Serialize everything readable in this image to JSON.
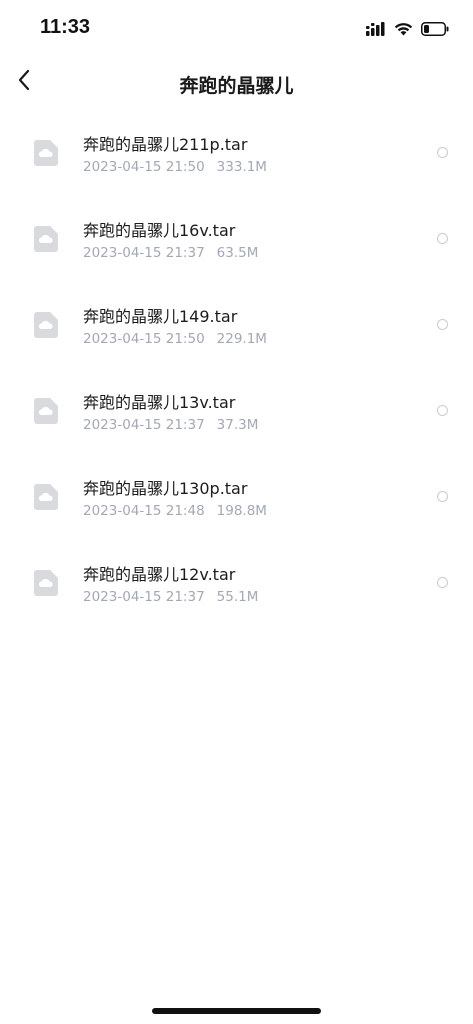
{
  "status_bar": {
    "time": "11:33",
    "icons": [
      "cellular-signal-icon",
      "wifi-icon",
      "battery-icon"
    ]
  },
  "nav": {
    "title": "奔跑的晶骡儿",
    "back_icon": "chevron-left-icon"
  },
  "files": [
    {
      "name": "奔跑的晶骡儿211p.tar",
      "date": "2023-04-15 21:50",
      "size": "333.1M"
    },
    {
      "name": "奔跑的晶骡儿16v.tar",
      "date": "2023-04-15 21:37",
      "size": "63.5M"
    },
    {
      "name": "奔跑的晶骡儿149.tar",
      "date": "2023-04-15 21:50",
      "size": "229.1M"
    },
    {
      "name": "奔跑的晶骡儿13v.tar",
      "date": "2023-04-15 21:37",
      "size": "37.3M"
    },
    {
      "name": "奔跑的晶骡儿130p.tar",
      "date": "2023-04-15 21:48",
      "size": "198.8M"
    },
    {
      "name": "奔跑的晶骡儿12v.tar",
      "date": "2023-04-15 21:37",
      "size": "55.1M"
    }
  ],
  "colors": {
    "title_text": "#1a1a1a",
    "meta_text": "#a3a8b4",
    "radio_border": "#c9ccd3",
    "file_icon": "#d9dade"
  }
}
